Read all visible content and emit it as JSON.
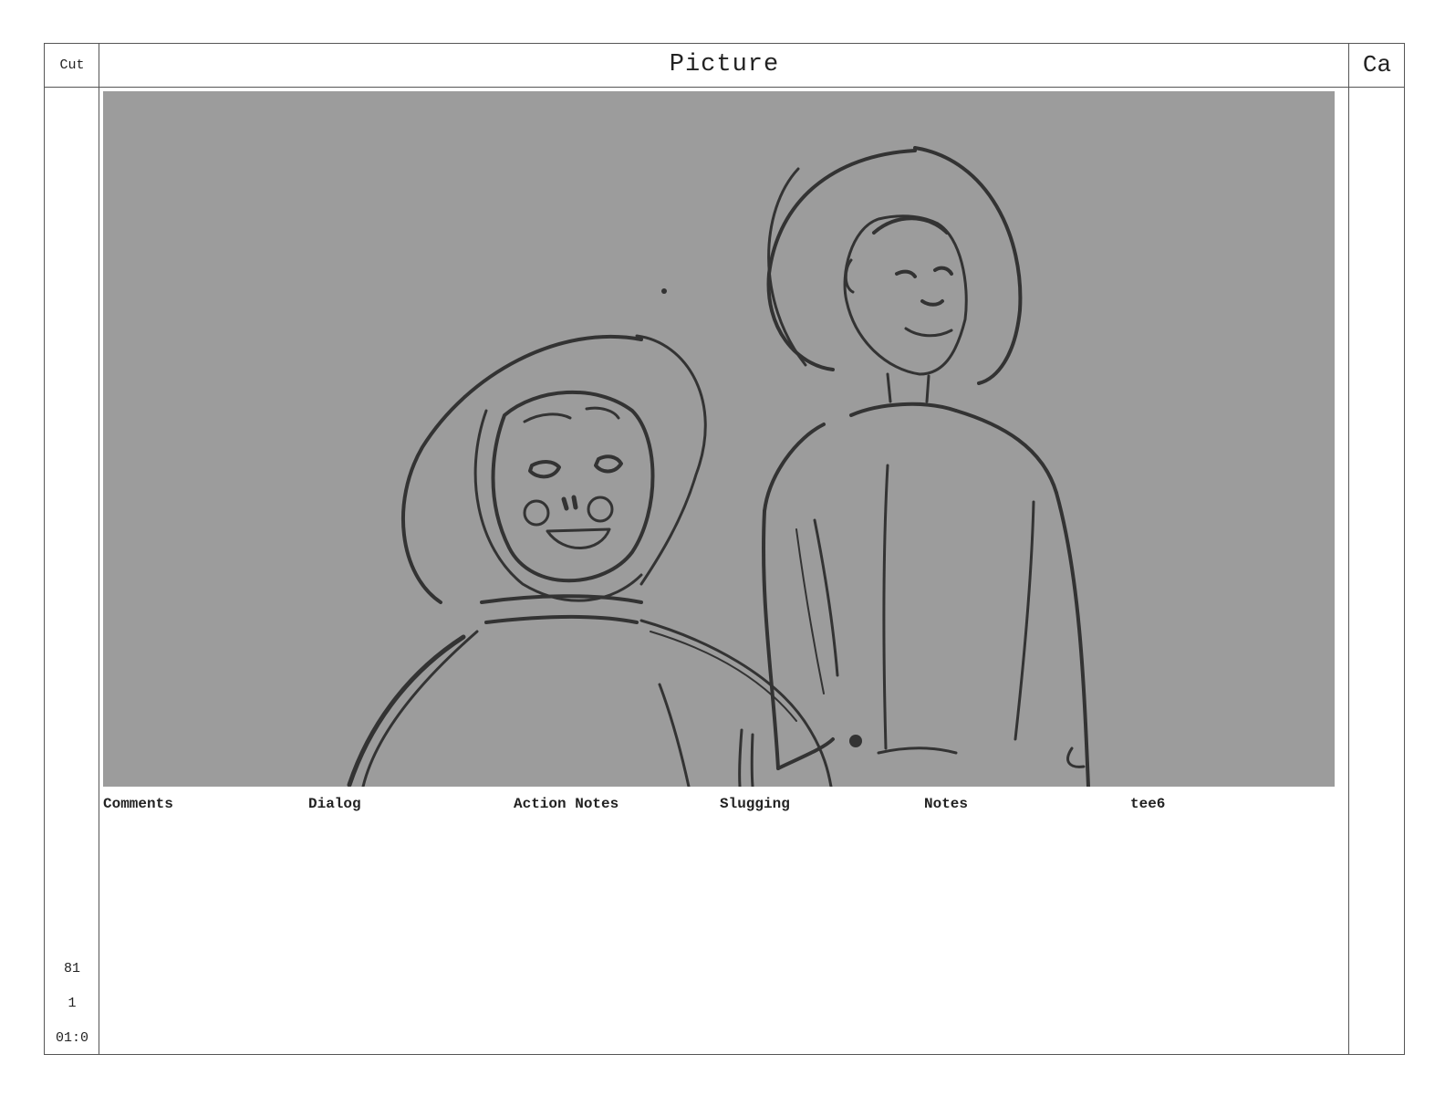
{
  "header": {
    "cut_label": "Cut",
    "picture_label": "Picture",
    "camera_label": "Ca"
  },
  "panel": {
    "background_color": "#9c9c9c",
    "line_color": "#333333",
    "sketch_subjects": [
      "small-astronaut",
      "tall-astronaut"
    ]
  },
  "fields": {
    "comments": "Comments",
    "dialog": "Dialog",
    "action_notes": "Action Notes",
    "slugging": "Slugging",
    "notes": "Notes",
    "custom": "tee6"
  },
  "cut_info": {
    "scene": "81",
    "panel": "1",
    "timing": "01:0"
  }
}
